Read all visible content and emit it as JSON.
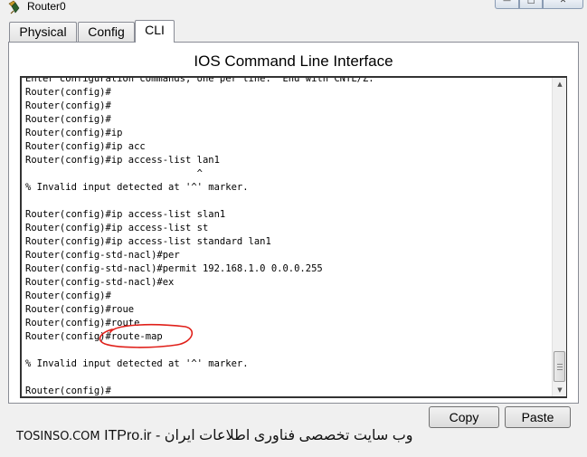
{
  "window": {
    "title": "Router0",
    "icon": "router-icon",
    "buttons": {
      "minimize": "—",
      "maximize": "□",
      "close": "✕"
    }
  },
  "tabs": [
    {
      "label": "Physical",
      "active": false
    },
    {
      "label": "Config",
      "active": false
    },
    {
      "label": "CLI",
      "active": true
    }
  ],
  "panel": {
    "title": "IOS Command Line Interface"
  },
  "terminal": {
    "lines": [
      "Enter configuration commands, one per line.  End with CNTL/Z.",
      "Router(config)#",
      "Router(config)#",
      "Router(config)#",
      "Router(config)#ip",
      "Router(config)#ip acc",
      "Router(config)#ip access-list lan1",
      "                              ^",
      "% Invalid input detected at '^' marker.",
      "",
      "Router(config)#ip access-list slan1",
      "Router(config)#ip access-list st",
      "Router(config)#ip access-list standard lan1",
      "Router(config-std-nacl)#per",
      "Router(config-std-nacl)#permit 192.168.1.0 0.0.0.255",
      "Router(config-std-nacl)#ex",
      "Router(config)#",
      "Router(config)#roue",
      "Router(config)#route",
      "Router(config)#route-map",
      "",
      "% Invalid input detected at '^' marker.",
      "",
      "Router(config)#"
    ],
    "annotation_color": "#e0201a"
  },
  "buttons": {
    "copy": "Copy",
    "paste": "Paste"
  },
  "watermark": {
    "latin": "TOSINSO.COM",
    "persian": "وب سایت تخصصی فناوری اطلاعات ایران - ITPro.ir"
  }
}
